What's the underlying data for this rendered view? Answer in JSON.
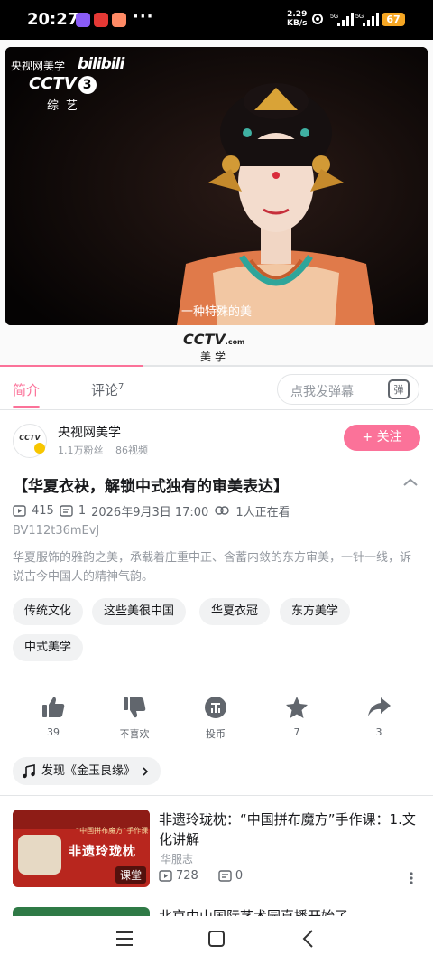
{
  "status_bar": {
    "time": "20:27",
    "net_speed_value": "2.29",
    "net_speed_unit": "KB/s",
    "signal1": "5G",
    "signal2": "5G",
    "battery": "67"
  },
  "video": {
    "watermark_channel": "央视网美学",
    "watermark_site": "bilibili",
    "channel_logo": "CCTV",
    "channel_number": "3",
    "channel_label": "综艺",
    "subtitle": "一种特殊的美",
    "brand_logo": "CCTV",
    "brand_logo_suffix": ".com",
    "brand_name": "美学"
  },
  "tabs": {
    "intro": "简介",
    "comments": "评论",
    "comments_count": "7",
    "danmaku_placeholder": "点我发弹幕",
    "danmaku_button": "弹"
  },
  "uploader": {
    "avatar_text": "CCTV",
    "name": "央视网美学",
    "fans": "1.1万粉丝",
    "videos": "86视频",
    "follow_label": "+ 关注"
  },
  "video_info": {
    "title": "【华夏衣袂，解锁中式独有的审美表达】",
    "plays": "415",
    "danmaku_count": "1",
    "publish_date": "2026年9月3日 17:00",
    "watching": "1人正在看",
    "bvid": "BV112t36mEvJ",
    "description": "华夏服饰的雅韵之美，承载着庄重中正、含蓄内敛的东方审美，一针一线，诉说古今中国人的精神气韵。"
  },
  "tags": [
    "传统文化",
    "这些美很中国",
    "华夏衣冠",
    "东方美学",
    "中式美学"
  ],
  "actions": {
    "like": "39",
    "dislike": "不喜欢",
    "coin": "投币",
    "favorite": "7",
    "share": "3"
  },
  "music": {
    "label": "发现《金玉良缘》"
  },
  "related": [
    {
      "title": "非遗玲珑枕：“中国拼布魔方”手作课：1.文化讲解",
      "author": "华服志",
      "plays": "728",
      "danmaku": "0",
      "thumb_title": "非遗玲珑枕",
      "thumb_subtitle": "“中国拼布魔方”手作课",
      "thumb_badge": "课堂"
    },
    {
      "title": "北京中山国际艺术园直播开始了"
    }
  ],
  "colors": {
    "accent": "#fb7299",
    "text_primary": "#18191c",
    "text_secondary": "#61666d",
    "text_tertiary": "#9499a0",
    "chip_bg": "#f1f2f3"
  },
  "progress": 0.33
}
